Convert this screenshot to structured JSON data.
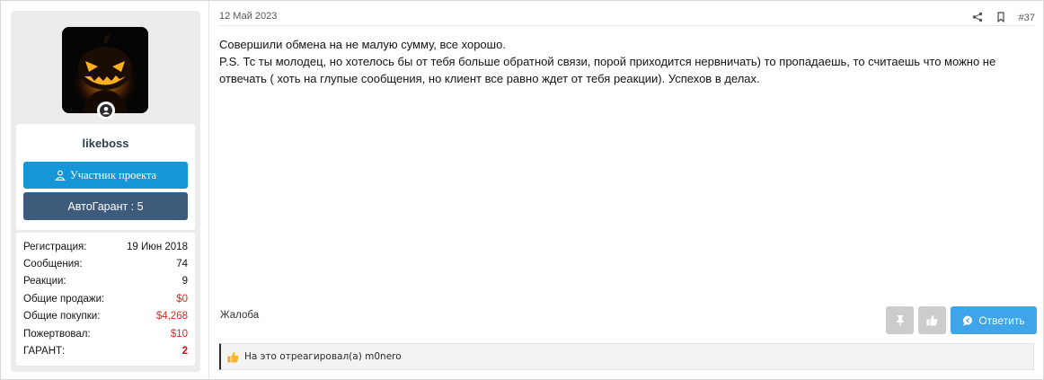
{
  "user": {
    "username": "likeboss",
    "member_label": "Участник проекта",
    "garant_label": "АвтоГарант : 5",
    "online_status_icon": "user-online-icon",
    "stats": [
      {
        "label": "Регистрация:",
        "value": "19 Июн 2018",
        "kind": "plain"
      },
      {
        "label": "Сообщения:",
        "value": "74",
        "kind": "plain"
      },
      {
        "label": "Реакции:",
        "value": "9",
        "kind": "plain"
      },
      {
        "label": "Общие продажи:",
        "value": "$0",
        "kind": "money"
      },
      {
        "label": "Общие покупки:",
        "value": "$4,268",
        "kind": "money"
      },
      {
        "label": "Пожертвовал:",
        "value": "$10",
        "kind": "money"
      },
      {
        "label": "ГАРАНТ:",
        "value": "2",
        "kind": "garant"
      }
    ]
  },
  "message": {
    "date": "12 Май 2023",
    "number": "#37",
    "paragraphs": [
      "Совершили обмена на не малую сумму, все хорошо.",
      "P.S. Тс ты молодец, но хотелось бы от тебя больше обратной связи, порой приходится нервничать) то пропадаешь, то считаешь что можно не отвечать ( хоть на глупые сообщения, но клиент все равно ждет от тебя реакции). Успехов в делах."
    ],
    "report_label": "Жалоба",
    "reply_label": "Ответить",
    "reaction_text": "На это отреагировал(а) m0nero"
  },
  "colors": {
    "member_button": "#1596d6",
    "garant_button": "#3f5b7b",
    "reply_button": "#3fa4e8",
    "money_value": "#d42b1e",
    "garant_value": "#e0100e"
  },
  "icons": {
    "share": "share-icon",
    "bookmark": "bookmark-icon",
    "pin": "pin-icon",
    "like": "thumbs-up-icon",
    "reply": "reply-bubble-icon",
    "reaction": "thumbs-up-reaction-icon"
  }
}
